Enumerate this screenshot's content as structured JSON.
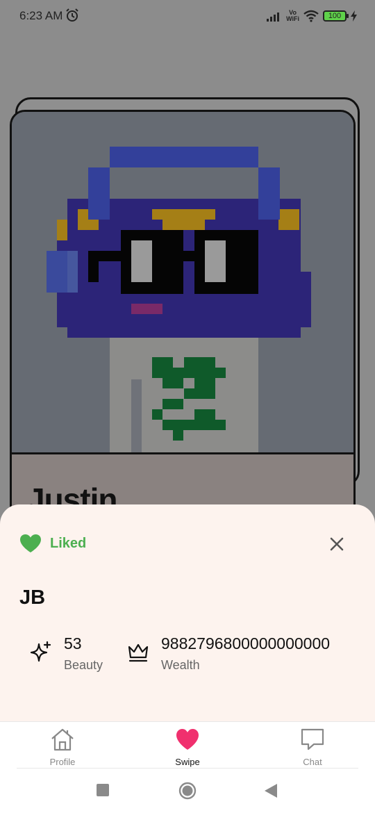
{
  "status_bar": {
    "time": "6:23 AM",
    "network_label_top": "Vo",
    "network_label_bottom": "WiFi",
    "battery": "100",
    "icons": [
      "alarm-icon",
      "signal-icon",
      "wifi-icon",
      "battery-icon",
      "charging-icon"
    ]
  },
  "card": {
    "name": "Justin"
  },
  "sheet": {
    "status_label": "Liked",
    "status_color": "#4caf50",
    "name": "JB",
    "stats": {
      "beauty": {
        "value": "53",
        "label": "Beauty",
        "icon": "sparkle-icon"
      },
      "wealth": {
        "value": "9882796800000000000",
        "label": "Wealth",
        "icon": "crown-icon"
      }
    }
  },
  "nav": {
    "items": [
      {
        "label": "Profile",
        "icon": "home-icon"
      },
      {
        "label": "Swipe",
        "icon": "heart-icon",
        "active_color": "#f0306e"
      },
      {
        "label": "Chat",
        "icon": "chat-icon"
      }
    ]
  },
  "system_nav": [
    "recents-button",
    "home-button",
    "back-button"
  ]
}
